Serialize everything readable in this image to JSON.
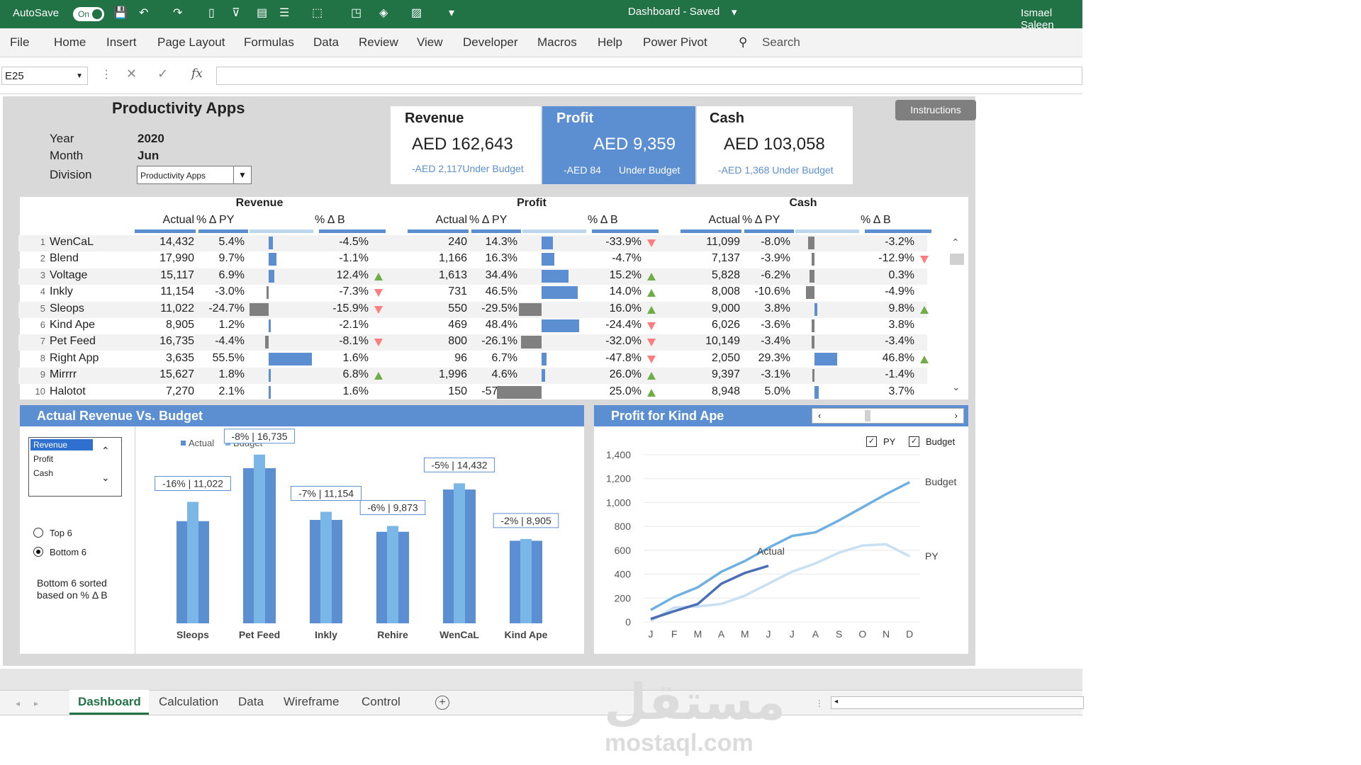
{
  "titlebar": {
    "autosave_label": "AutoSave",
    "autosave_state": "On",
    "doc_title": "Dashboard  -  Saved",
    "user": "Ismael Saleen"
  },
  "ribbon": {
    "tabs": [
      "File",
      "Home",
      "Insert",
      "Page Layout",
      "Formulas",
      "Data",
      "Review",
      "View",
      "Developer",
      "Macros",
      "Help",
      "Power Pivot"
    ],
    "search": "Search"
  },
  "formula": {
    "namebox": "E25",
    "fx": "fx"
  },
  "dashboard": {
    "title": "Productivity Apps",
    "filters": {
      "year_label": "Year",
      "year": "2020",
      "month_label": "Month",
      "month": "Jun",
      "division_label": "Division",
      "division": "Productivity Apps"
    },
    "instructions": "Instructions",
    "kpis": [
      {
        "title": "Revenue",
        "value": "AED 162,643",
        "sub": "-AED 2,117Under Budget"
      },
      {
        "title": "Profit",
        "value": "AED 9,359",
        "sub1": "-AED 84",
        "sub2": "Under Budget"
      },
      {
        "title": "Cash",
        "value": "AED 103,058",
        "sub": "-AED 1,368 Under Budget"
      }
    ],
    "groups": [
      "Revenue",
      "Profit",
      "Cash"
    ],
    "cols": {
      "actual": "Actual",
      "py": "% Δ PY",
      "b": "% Δ B"
    },
    "rows": [
      {
        "n": "1",
        "name": "WenCaL",
        "r": [
          "14,432",
          "5.4%",
          "-4.5%"
        ],
        "p": [
          "240",
          "14.3%",
          "-33.9%"
        ],
        "c": [
          "11,099",
          "-8.0%",
          "-3.2%"
        ]
      },
      {
        "n": "2",
        "name": "Blend",
        "r": [
          "17,990",
          "9.7%",
          "-1.1%"
        ],
        "p": [
          "1,166",
          "16.3%",
          "-4.7%"
        ],
        "c": [
          "7,137",
          "-3.9%",
          "-12.9%"
        ]
      },
      {
        "n": "3",
        "name": "Voltage",
        "r": [
          "15,117",
          "6.9%",
          "12.4%"
        ],
        "p": [
          "1,613",
          "34.4%",
          "15.2%"
        ],
        "c": [
          "5,828",
          "-6.2%",
          "0.3%"
        ]
      },
      {
        "n": "4",
        "name": "Inkly",
        "r": [
          "11,154",
          "-3.0%",
          "-7.3%"
        ],
        "p": [
          "731",
          "46.5%",
          "14.0%"
        ],
        "c": [
          "8,008",
          "-10.6%",
          "-4.9%"
        ]
      },
      {
        "n": "5",
        "name": "Sleops",
        "r": [
          "11,022",
          "-24.7%",
          "-15.9%"
        ],
        "p": [
          "550",
          "-29.5%",
          "16.0%"
        ],
        "c": [
          "9,000",
          "3.8%",
          "9.8%"
        ]
      },
      {
        "n": "6",
        "name": "Kind Ape",
        "r": [
          "8,905",
          "1.2%",
          "-2.1%"
        ],
        "p": [
          "469",
          "48.4%",
          "-24.4%"
        ],
        "c": [
          "6,026",
          "-3.6%",
          "3.8%"
        ]
      },
      {
        "n": "7",
        "name": "Pet Feed",
        "r": [
          "16,735",
          "-4.4%",
          "-8.1%"
        ],
        "p": [
          "800",
          "-26.1%",
          "-32.0%"
        ],
        "c": [
          "10,149",
          "-3.4%",
          "-3.4%"
        ]
      },
      {
        "n": "8",
        "name": "Right App",
        "r": [
          "3,635",
          "55.5%",
          "1.6%"
        ],
        "p": [
          "96",
          "6.7%",
          "-47.8%"
        ],
        "c": [
          "2,050",
          "29.3%",
          "46.8%"
        ]
      },
      {
        "n": "9",
        "name": "Mirrrr",
        "r": [
          "15,627",
          "1.8%",
          "6.8%"
        ],
        "p": [
          "1,996",
          "4.6%",
          "26.0%"
        ],
        "c": [
          "9,397",
          "-3.1%",
          "-1.4%"
        ]
      },
      {
        "n": "10",
        "name": "Halotot",
        "r": [
          "7,270",
          "2.1%",
          "1.6%"
        ],
        "p": [
          "150",
          "-57.0%",
          "25.0%"
        ],
        "c": [
          "8,948",
          "5.0%",
          "3.7%"
        ]
      }
    ],
    "rev_panel": {
      "title": "Actual Revenue Vs. Budget",
      "list": [
        "Revenue",
        "Profit",
        "Cash"
      ],
      "top6": "Top 6",
      "bottom6": "Bottom 6",
      "note1": "Bottom 6 sorted",
      "note2": "based on % Δ B"
    },
    "profit_panel": {
      "title": "Profit for Kind Ape",
      "py": "PY",
      "budget": "Budget"
    }
  },
  "sheet_tabs": [
    "Dashboard",
    "Calculation",
    "Data",
    "Wireframe",
    "Control"
  ],
  "watermark": {
    "ar": "مستقل",
    "en": "mostaql.com"
  },
  "colors": {
    "excel_green": "#217346",
    "accent": "#5b8fd2",
    "light": "#7ab6e6",
    "gray_bar": "#808080",
    "up": "#70ad47",
    "down": "#ff7c80"
  },
  "chart_data": [
    {
      "type": "bar",
      "categories": [
        "Sleops",
        "Pet Feed",
        "Inkly",
        "Rehire",
        "WenCaL",
        "Kind Ape"
      ],
      "series": [
        {
          "name": "Actual",
          "values": [
            11022,
            16735,
            11154,
            9873,
            14432,
            8905
          ]
        },
        {
          "name": "Budget",
          "values": [
            13100,
            18200,
            12030,
            10500,
            15100,
            9100
          ]
        }
      ],
      "labels": [
        "-16% | 11,022",
        "-8% | 16,735",
        "-7% | 11,154",
        "-6% | 9,873",
        "-5% | 14,432",
        "-2% | 8,905"
      ],
      "legend": [
        "Actual",
        "Budget"
      ],
      "ylim": [
        0,
        20000
      ]
    },
    {
      "type": "line",
      "x": [
        "J",
        "F",
        "M",
        "A",
        "M",
        "J",
        "J",
        "A",
        "S",
        "O",
        "N",
        "D"
      ],
      "yticks": [
        "0",
        "200",
        "400",
        "600",
        "800",
        "1,000",
        "1,200",
        "1,400"
      ],
      "ylim": [
        0,
        1400
      ],
      "series": [
        {
          "name": "Actual",
          "values": [
            25,
            90,
            150,
            320,
            410,
            470
          ]
        },
        {
          "name": "Budget",
          "values": [
            100,
            210,
            290,
            420,
            510,
            620,
            720,
            750,
            850,
            960,
            1070,
            1170
          ]
        },
        {
          "name": "PY",
          "values": [
            10,
            120,
            130,
            150,
            220,
            320,
            420,
            490,
            580,
            640,
            650,
            550
          ]
        }
      ]
    }
  ]
}
